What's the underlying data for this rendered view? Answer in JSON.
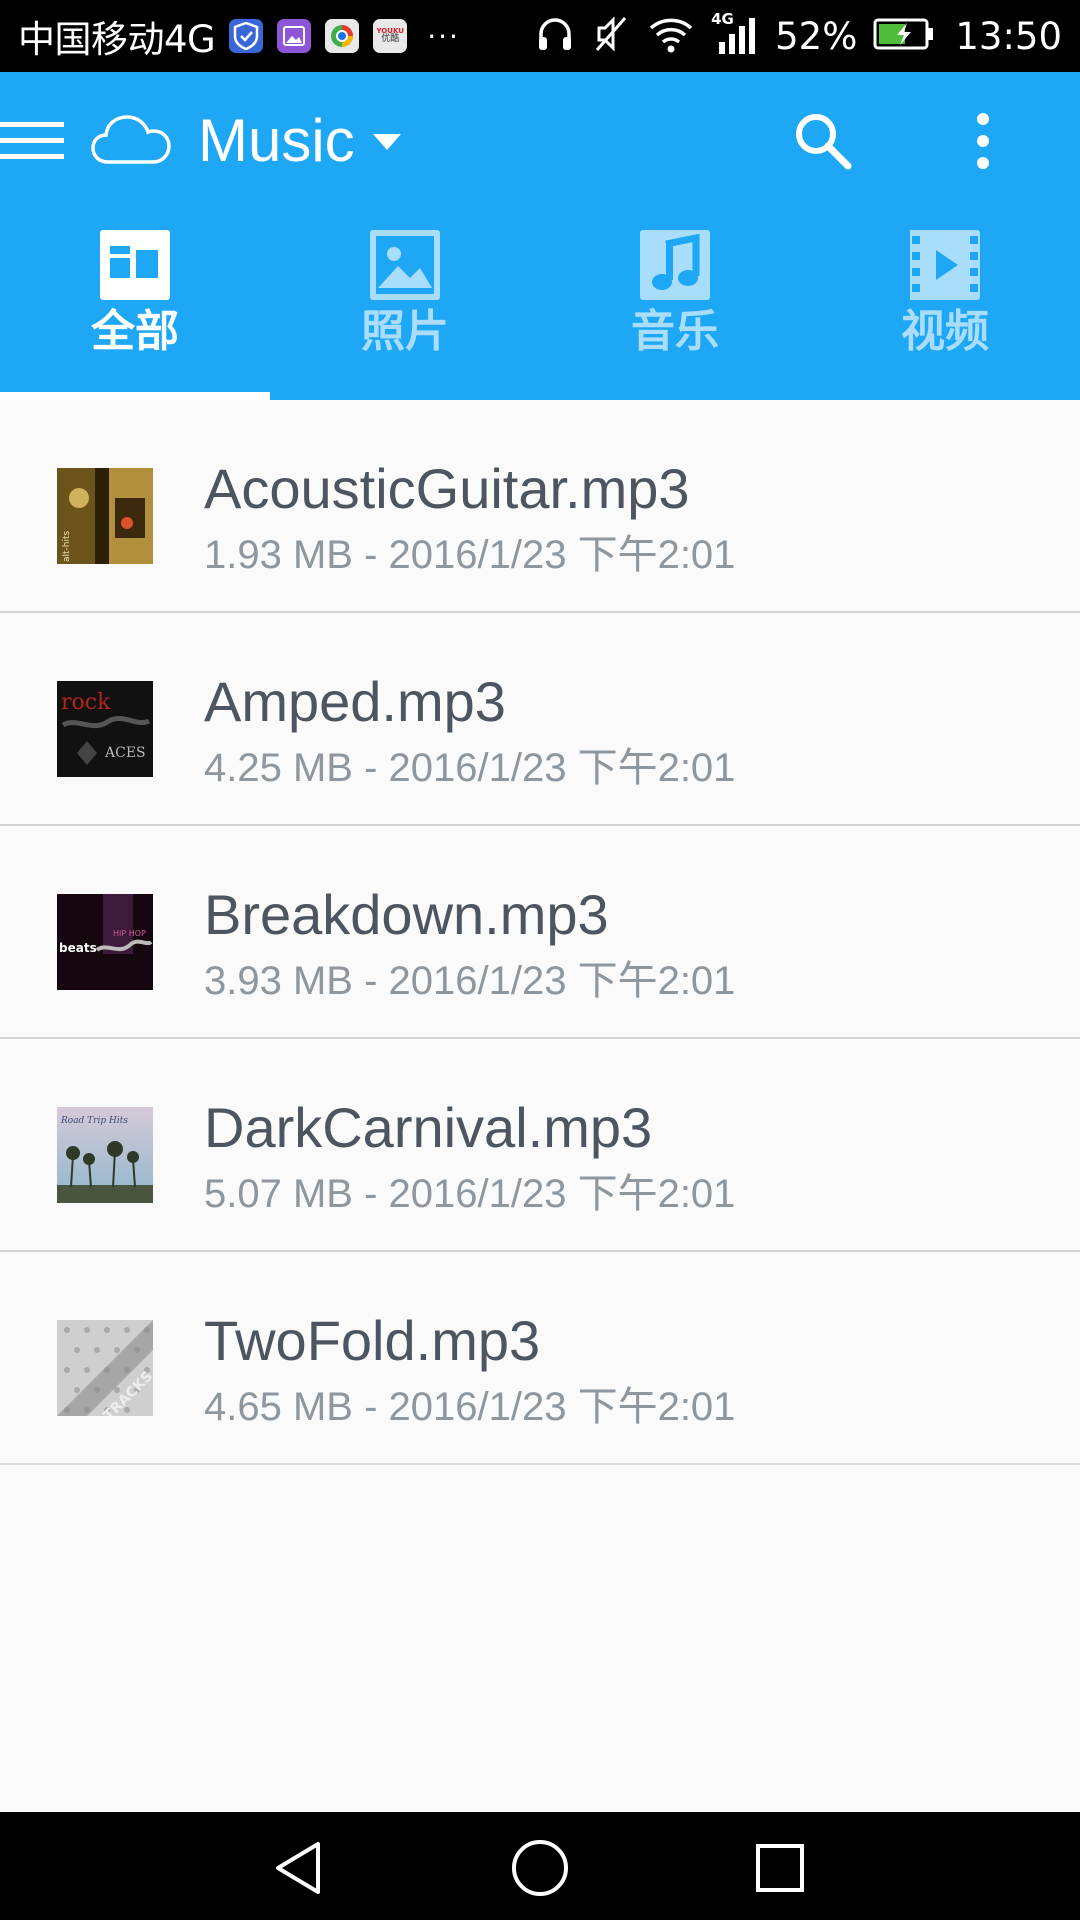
{
  "status_bar": {
    "carrier": "中国移动4G",
    "notification_icons": [
      "shield-icon",
      "gallery-icon",
      "browser-icon",
      "youku-icon"
    ],
    "youku_text_top": "YOUKU",
    "youku_text_bottom": "优酷",
    "more_notifications": "···",
    "network_type": "4G",
    "battery_percent": "52%",
    "time": "13:50"
  },
  "app_bar": {
    "title": "Music",
    "color": "#1ea7f5"
  },
  "tabs": [
    {
      "label": "全部",
      "icon": "all-icon",
      "active": true
    },
    {
      "label": "照片",
      "icon": "photo-icon",
      "active": false
    },
    {
      "label": "音乐",
      "icon": "music-icon",
      "active": false
    },
    {
      "label": "视频",
      "icon": "video-icon",
      "active": false
    }
  ],
  "files": [
    {
      "name": "AcousticGuitar.mp3",
      "meta": "1.93 MB - 2016/1/23 下午2:01",
      "thumb_text": "alt-hits"
    },
    {
      "name": "Amped.mp3",
      "meta": "4.25 MB - 2016/1/23 下午2:01",
      "thumb_text": "rock",
      "thumb_text_2": "ACES"
    },
    {
      "name": "Breakdown.mp3",
      "meta": "3.93 MB - 2016/1/23 下午2:01",
      "thumb_text": "beats",
      "thumb_text_2": "HIP HOP"
    },
    {
      "name": "DarkCarnival.mp3",
      "meta": "5.07 MB - 2016/1/23 下午2:01",
      "thumb_text": "Road Trip Hits"
    },
    {
      "name": "TwoFold.mp3",
      "meta": "4.65 MB - 2016/1/23 下午2:01",
      "thumb_text": "TRACKS"
    }
  ]
}
